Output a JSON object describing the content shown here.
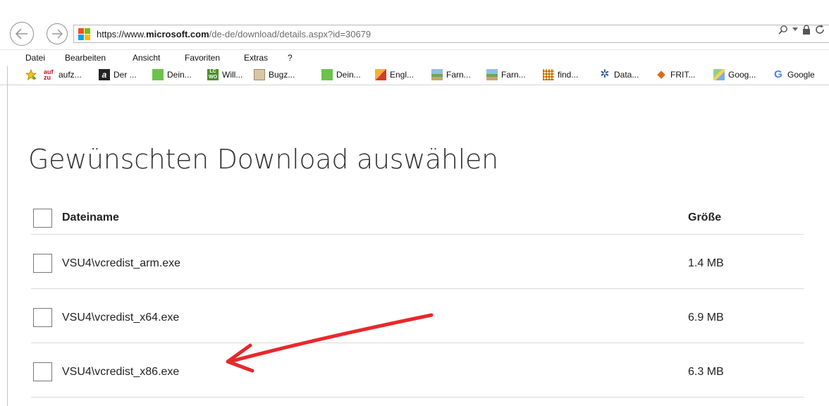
{
  "browser": {
    "url_prefix": "https://www.",
    "url_domain": "microsoft.com",
    "url_rest": "/de-de/download/details.aspx?id=30679",
    "menu": [
      "Datei",
      "Bearbeiten",
      "Ansicht",
      "Favoriten",
      "Extras",
      "?"
    ],
    "favorites": [
      {
        "label": "aufz...",
        "icon": "auf-zu-icon"
      },
      {
        "label": "Der ...",
        "icon": "letter-a-icon"
      },
      {
        "label": "Dein...",
        "icon": "green-square-icon"
      },
      {
        "label": "Will...",
        "icon": "lcwo-icon"
      },
      {
        "label": "Bugz...",
        "icon": "bugzilla-icon"
      },
      {
        "label": "Dein...",
        "icon": "green-square-icon"
      },
      {
        "label": "Engl...",
        "icon": "dictionary-icon"
      },
      {
        "label": "Farn...",
        "icon": "landscape-icon"
      },
      {
        "label": "Farn...",
        "icon": "landscape-icon"
      },
      {
        "label": "find...",
        "icon": "grid-icon"
      },
      {
        "label": "Data...",
        "icon": "gear-icon"
      },
      {
        "label": "FRIT...",
        "icon": "diamond-icon"
      },
      {
        "label": "Goog...",
        "icon": "maps-icon"
      },
      {
        "label": "Google",
        "icon": "google-g-icon"
      }
    ]
  },
  "page": {
    "title": "Gewünschten Download auswählen",
    "header": {
      "name": "Dateiname",
      "size": "Größe"
    },
    "files": [
      {
        "name": "VSU4\\vcredist_arm.exe",
        "size": "1.4 MB"
      },
      {
        "name": "VSU4\\vcredist_x64.exe",
        "size": "6.9 MB"
      },
      {
        "name": "VSU4\\vcredist_x86.exe",
        "size": "6.3 MB"
      }
    ]
  },
  "annotation": {
    "color": "#e8282b"
  }
}
